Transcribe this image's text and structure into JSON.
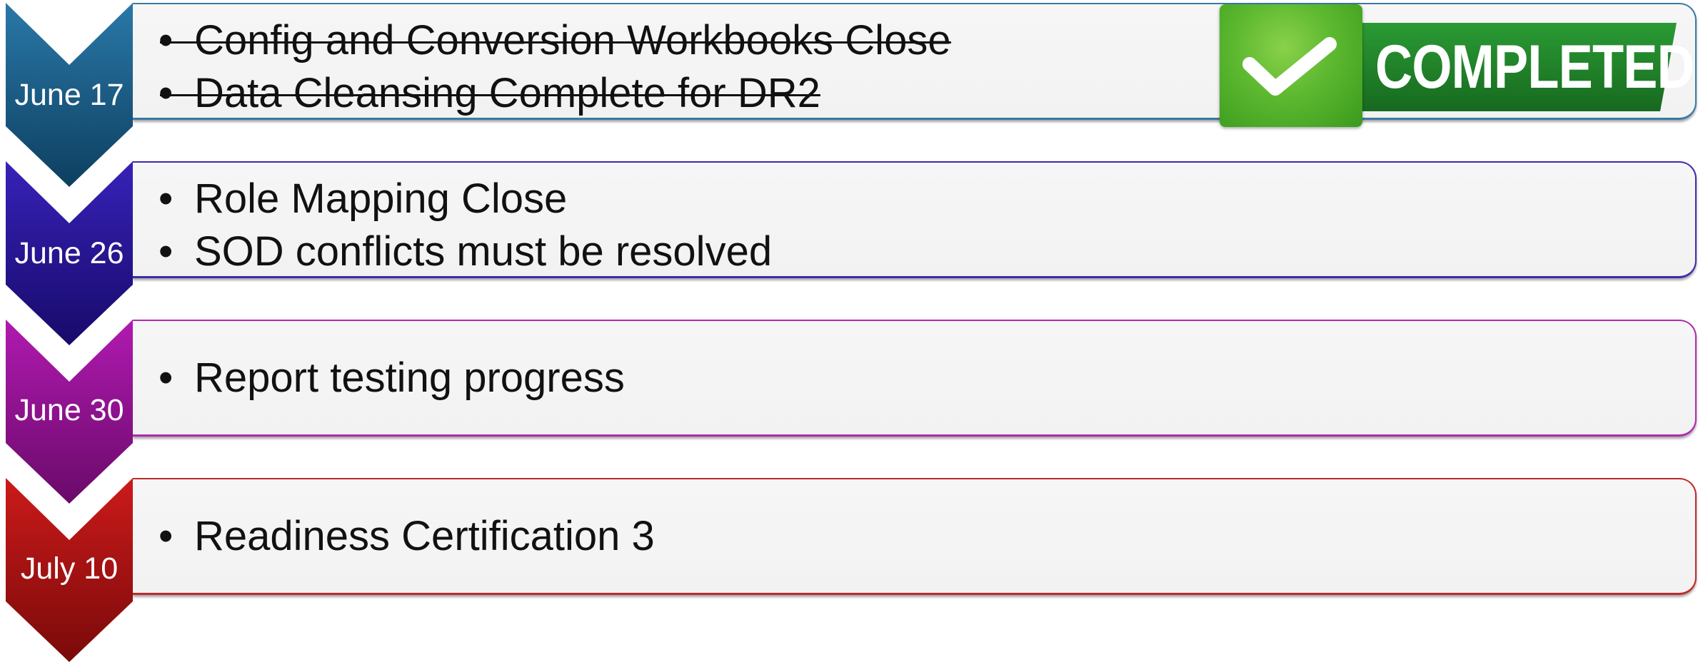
{
  "milestones": [
    {
      "date": "June 17",
      "color_top": "#2a78a8",
      "color_bottom": "#0d3f60",
      "border": "#3a7aa4",
      "items": [
        "Config and Conversion Workbooks Close",
        "Data Cleansing Complete for DR2"
      ],
      "struck_through": true,
      "badge": "COMPLETED"
    },
    {
      "date": "June 26",
      "color_top": "#3722b8",
      "color_bottom": "#170a6a",
      "border": "#3b2cb0",
      "items": [
        "Role Mapping Close",
        "SOD conflicts must be resolved"
      ],
      "struck_through": false
    },
    {
      "date": "June 30",
      "color_top": "#b01ab0",
      "color_bottom": "#6a0a6a",
      "border": "#b02ab0",
      "items": [
        "Report testing progress"
      ],
      "struck_through": false
    },
    {
      "date": "July 10",
      "color_top": "#cc1a1a",
      "color_bottom": "#7a0a0a",
      "border": "#c02a2a",
      "items": [
        "Readiness Certification 3"
      ],
      "struck_through": false
    }
  ],
  "bullet_glyph": "•",
  "badge_icon": "checkmark-icon"
}
